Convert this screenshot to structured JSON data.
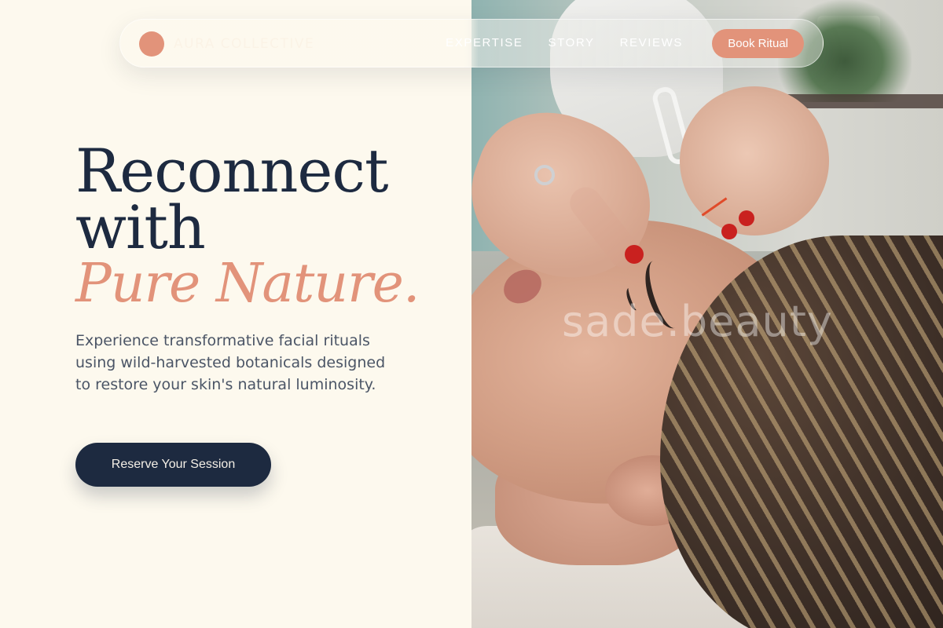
{
  "nav": {
    "brand_name": "AURA COLLECTIVE",
    "links": [
      "EXPERTISE",
      "STORY",
      "REVIEWS"
    ],
    "cta_label": "Book Ritual"
  },
  "hero": {
    "title_lines": [
      "Reconnect",
      "with"
    ],
    "title_accent": "Pure Nature.",
    "description": "Experience transformative facial rituals using wild-harvested botanicals designed to restore your skin's natural luminosity.",
    "cta_label": "Reserve Your Session"
  },
  "photo": {
    "watermark": "sade.beauty"
  },
  "colors": {
    "background": "#fdf9ee",
    "navy": "#1d2a40",
    "accent": "#e2937a",
    "text_muted": "#4b5566"
  }
}
